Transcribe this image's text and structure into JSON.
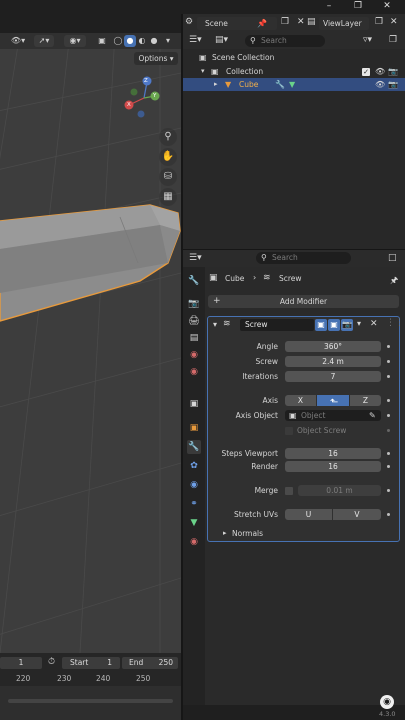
{
  "outliner": {
    "scene_name": "Scene",
    "view_layer": "ViewLayer",
    "search_placeholder": "Search",
    "rows": [
      {
        "label": "Scene Collection"
      },
      {
        "label": "Collection"
      },
      {
        "label": "Cube"
      }
    ]
  },
  "viewport": {
    "options_label": "Options",
    "gizmo_axes": {
      "x": "X",
      "y": "Y",
      "z": "Z"
    }
  },
  "timeline": {
    "current_frame": "1",
    "start_label": "Start",
    "start_value": "1",
    "end_label": "End",
    "end_value": "250",
    "ticks": [
      "220",
      "230",
      "240",
      "250"
    ]
  },
  "properties": {
    "search_placeholder": "Search",
    "breadcrumb_object": "Cube",
    "breadcrumb_modifier": "Screw",
    "add_modifier_label": "Add Modifier",
    "modifier_name": "Screw",
    "fields": {
      "angle_label": "Angle",
      "angle_value": "360°",
      "screw_label": "Screw",
      "screw_value": "2.4 m",
      "iterations_label": "Iterations",
      "iterations_value": "7",
      "axis_label": "Axis",
      "axis_x": "X",
      "axis_y": "Y",
      "axis_z": "Z",
      "axis_object_label": "Axis Object",
      "axis_object_placeholder": "Object",
      "object_screw_label": "Object Screw",
      "steps_viewport_label": "Steps Viewport",
      "steps_viewport_value": "16",
      "render_label": "Render",
      "render_value": "16",
      "merge_label": "Merge",
      "merge_value": "0.01 m",
      "stretch_uvs_label": "Stretch UVs",
      "stretch_u": "U",
      "stretch_v": "V",
      "normals_label": "Normals"
    }
  },
  "status": {
    "version": "4.3.0"
  },
  "colors": {
    "accent": "#4772b3",
    "selection_outline": "#e89a3c",
    "panel": "#2a2a2a",
    "field": "#545454"
  }
}
